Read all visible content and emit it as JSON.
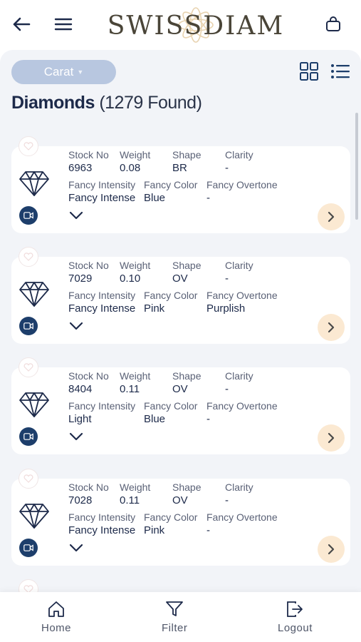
{
  "header": {
    "brand": "SWISSDIAM",
    "icons": [
      "back-arrow-icon",
      "menu-icon",
      "shopping-bag-icon"
    ]
  },
  "toolbar": {
    "filter_pill_label": "Carat",
    "view_icons": [
      "grid-view-icon",
      "list-view-icon"
    ]
  },
  "page": {
    "title": "Diamonds",
    "count_text": "(1279 Found)"
  },
  "labels": {
    "stock_no": "Stock No",
    "weight": "Weight",
    "shape": "Shape",
    "clarity": "Clarity",
    "fancy_intensity": "Fancy Intensity",
    "fancy_color": "Fancy Color",
    "fancy_overtone": "Fancy Overtone"
  },
  "diamonds": [
    {
      "stock_no": "6963",
      "weight": "0.08",
      "shape": "BR",
      "clarity": "-",
      "fancy_intensity": "Fancy Intense",
      "fancy_color": "Blue",
      "fancy_overtone": "-"
    },
    {
      "stock_no": "7029",
      "weight": "0.10",
      "shape": "OV",
      "clarity": "-",
      "fancy_intensity": "Fancy Intense",
      "fancy_color": "Pink",
      "fancy_overtone": "Purplish"
    },
    {
      "stock_no": "8404",
      "weight": "0.11",
      "shape": "OV",
      "clarity": "-",
      "fancy_intensity": "Light",
      "fancy_color": "Blue",
      "fancy_overtone": "-"
    },
    {
      "stock_no": "7028",
      "weight": "0.11",
      "shape": "OV",
      "clarity": "-",
      "fancy_intensity": "Fancy Intense",
      "fancy_color": "Pink",
      "fancy_overtone": "-"
    }
  ],
  "bottom_nav": {
    "home": "Home",
    "filter": "Filter",
    "logout": "Logout"
  },
  "colors": {
    "primary_navy": "#1d3e6b",
    "pill_blue": "#b8c7e0",
    "go_button_peach": "#fbe9d2",
    "background": "#f2f4f8"
  }
}
